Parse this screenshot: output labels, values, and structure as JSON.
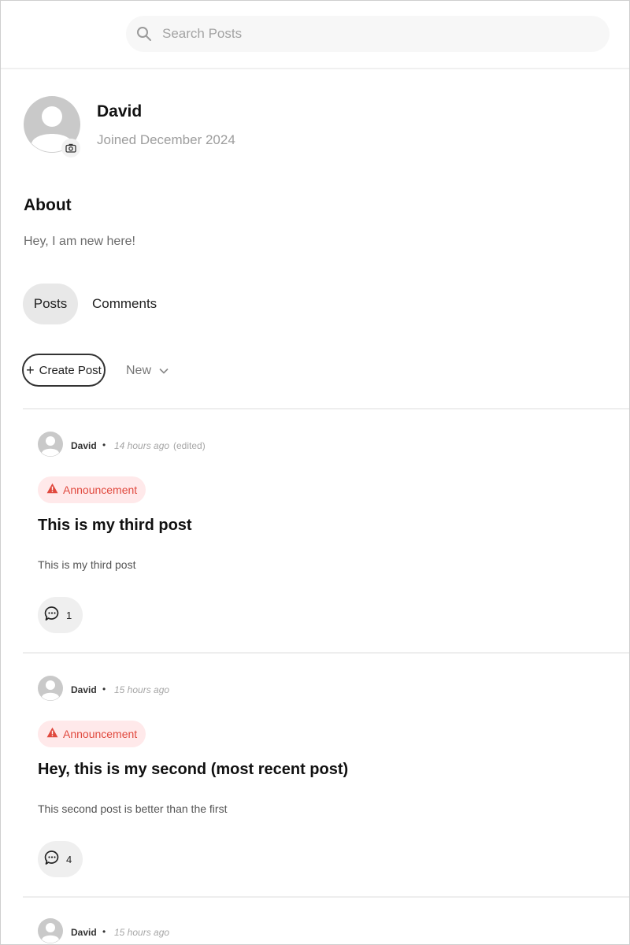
{
  "search": {
    "placeholder": "Search Posts"
  },
  "profile": {
    "name": "David",
    "joined": "Joined December 2024"
  },
  "about": {
    "title": "About",
    "text": "Hey, I am new here!"
  },
  "tabs": [
    {
      "label": "Posts",
      "active": true
    },
    {
      "label": "Comments",
      "active": false
    }
  ],
  "toolbar": {
    "create_label": "Create Post",
    "sort_label": "New"
  },
  "posts": [
    {
      "author": "David",
      "time": "14 hours ago",
      "edited": "(edited)",
      "flair": "Announcement",
      "title": "This is my third post",
      "body": "This is my third post",
      "comments": "1"
    },
    {
      "author": "David",
      "time": "15 hours ago",
      "edited": "",
      "flair": "Announcement",
      "title": "Hey, this is my second (most recent post)",
      "body": "This second post is better than the first",
      "comments": "4"
    },
    {
      "author": "David",
      "time": "15 hours ago"
    }
  ],
  "colors": {
    "accent_red": "#e0493e",
    "badge_bg": "#ffe9ea",
    "tab_active_bg": "#e8e8e8"
  }
}
